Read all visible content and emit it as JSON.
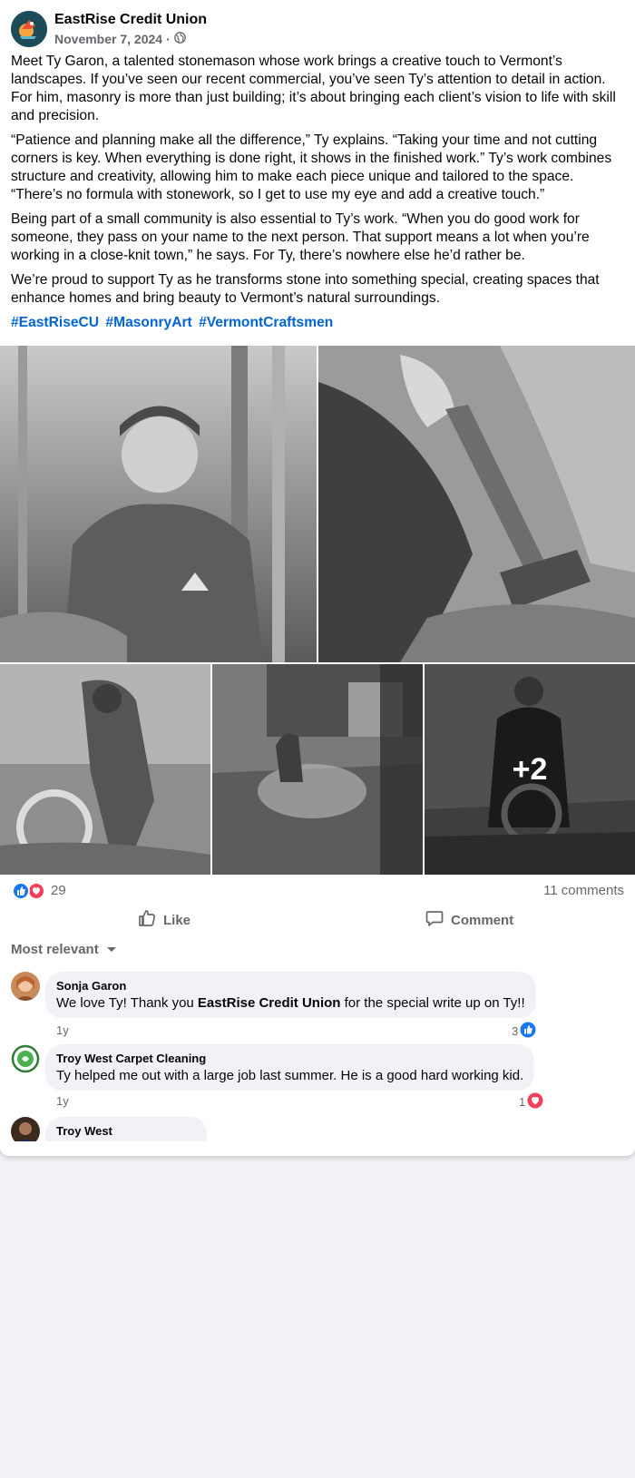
{
  "post": {
    "page_name": "EastRise Credit Union",
    "date": "November 7, 2024",
    "separator": "·",
    "audience_icon": "globe-icon",
    "paragraphs": [
      "Meet Ty Garon, a talented stonemason whose work brings a creative touch to Vermont’s landscapes. If you’ve seen our recent commercial, you’ve seen Ty’s attention to detail in action. For him, masonry is more than just building; it’s about bringing each client’s vision to life with skill and precision.",
      "“Patience and planning make all the difference,” Ty explains. “Taking your time and not cutting corners is key. When everything is done right, it shows in the finished work.” Ty’s work combines structure and creativity, allowing him to make each piece unique and tailored to the space. “There’s no formula with stonework, so I get to use my eye and add a creative touch.”",
      "Being part of a small community is also essential to Ty’s work. “When you do good work for someone, they pass on your name to the next person. That support means a lot when you’re working in a close-knit town,” he says. For Ty, there’s nowhere else he’d rather be.",
      "We’re proud to support Ty as he transforms stone into something special, creating spaces that enhance homes and bring beauty to Vermont’s natural surroundings."
    ],
    "hashtags": [
      "#EastRiseCU",
      "#MasonryArt",
      "#VermontCraftsmen"
    ],
    "more_photos": "+2"
  },
  "stats": {
    "reaction_count": "29",
    "reaction_icons": [
      "like-icon",
      "love-icon"
    ],
    "comment_count": "11 comments"
  },
  "actions": {
    "like_label": "Like",
    "comment_label": "Comment"
  },
  "comments_filter": "Most relevant",
  "comments": [
    {
      "name": "Sonja Garon",
      "text_before": "We love Ty! Thank you ",
      "mention": "EastRise Credit Union",
      "text_after": " for the special write up on Ty!!",
      "time": "1y",
      "reaction_count": "3",
      "reaction_icon": "like-icon"
    },
    {
      "name": "Troy West Carpet Cleaning",
      "text": "Ty helped me out with a large job last summer. He is a good hard working kid.",
      "time": "1y",
      "reaction_count": "1",
      "reaction_icon": "love-icon"
    },
    {
      "name": "Troy West"
    }
  ],
  "colors": {
    "link": "#0064d1",
    "like_blue": "#1877f2",
    "love_red": "#f33e58",
    "secondary_text": "#65676b",
    "bubble_bg": "#f0f2f5"
  }
}
